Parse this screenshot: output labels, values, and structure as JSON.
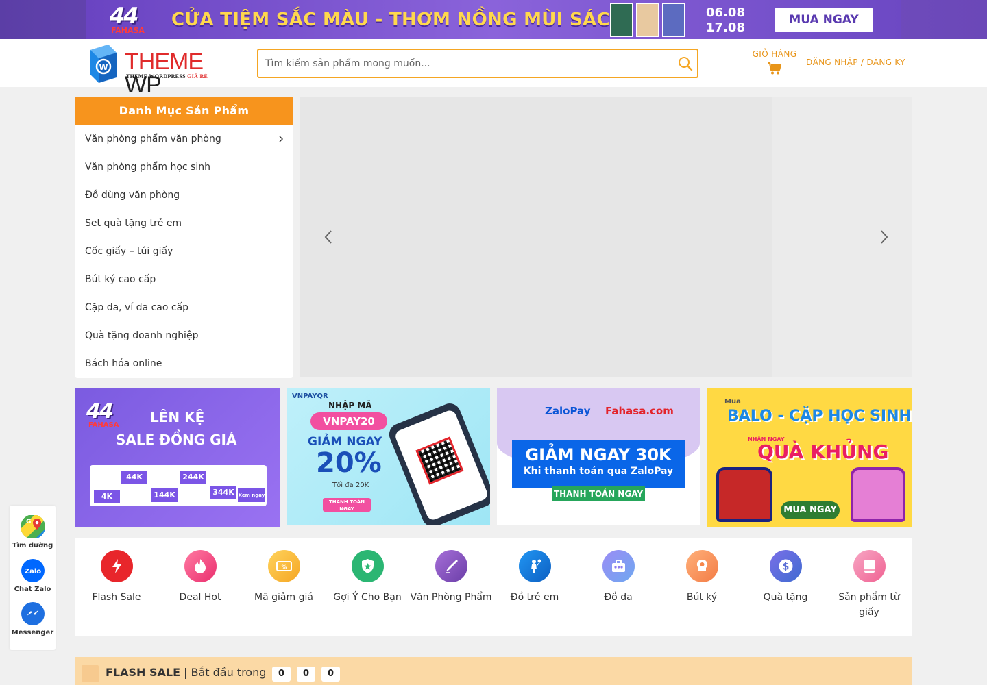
{
  "top_banner": {
    "brand_number": "44",
    "brand_name": "FAHASA",
    "slogan": "CỬA TIỆM SẮC MÀU - THƠM NỒNG MÙI SÁCH",
    "date_start": "06.08",
    "date_end": "17.08",
    "cta": "MUA NGAY"
  },
  "header": {
    "logo_part1": "THEME",
    "logo_part2": " WP",
    "logo_sub_part1": "THEME WORDPRESS ",
    "logo_sub_part2": "GIÁ RẺ",
    "search_placeholder": "Tìm kiếm sản phẩm mong muốn...",
    "cart_label": "GIỎ HÀNG",
    "login_label": "ĐĂNG NHẬP / ĐĂNG KÝ"
  },
  "category_menu": {
    "title": "Danh Mục Sản Phẩm",
    "items": [
      {
        "label": "Văn phòng phẩm văn phòng"
      },
      {
        "label": "Văn phòng phẩm học sinh"
      },
      {
        "label": "Đồ dùng văn phòng"
      },
      {
        "label": "Set quà tặng trẻ em"
      },
      {
        "label": "Cốc giấy – túi giấy"
      },
      {
        "label": "Bút ký cao cấp"
      },
      {
        "label": "Cặp da, ví da cao cấp"
      },
      {
        "label": "Quà tặng doanh nghiệp"
      },
      {
        "label": "Bách hóa online"
      }
    ]
  },
  "promos": {
    "p1": {
      "number": "44",
      "brand": "FAHASA",
      "line1": "LÊN KỆ",
      "line2": "SALE ĐỒNG GIÁ",
      "tags": [
        "44K",
        "244K",
        "144K",
        "344K",
        "4K"
      ],
      "cta": "Xem ngay"
    },
    "p2": {
      "brand": "VNPAY",
      "brand_suffix": "QR",
      "enter": "NHẬP MÃ",
      "code": "VNPAY20",
      "discount_label": "GIẢM NGAY",
      "discount": "20%",
      "max": "Tối đa 20K",
      "cta": "THANH TOÁN NGAY"
    },
    "p3": {
      "brand1": "ZaloPay",
      "brand2": "Fahasa.com",
      "headline": "GIẢM NGAY 30K",
      "subline": "Khi thanh toán qua ZaloPay",
      "cta": "THANH TOÁN NGAY"
    },
    "p4": {
      "prefix": "Mua",
      "line1": "BALO - CẶP HỌC SINH",
      "note": "NHẬN NGAY",
      "line2": "QUÀ KHỦNG",
      "cta": "MUA NGAY"
    }
  },
  "quick_categories": [
    {
      "label": "Flash Sale",
      "icon": "lightning-icon",
      "color": "#e8262b"
    },
    {
      "label": "Deal Hot",
      "icon": "flame-icon",
      "color": "#f0497e"
    },
    {
      "label": "Mã giảm giá",
      "icon": "coupon-icon",
      "color": "#f7b731"
    },
    {
      "label": "Gợi Ý Cho Bạn",
      "icon": "star-shield-icon",
      "color": "#2bb673"
    },
    {
      "label": "Văn Phòng Phẩm",
      "icon": "pen-icon",
      "color": "#8e44ad"
    },
    {
      "label": "Đồ trẻ em",
      "icon": "child-icon",
      "color": "#1e88e5"
    },
    {
      "label": "Đồ da",
      "icon": "briefcase-icon",
      "color": "#8d7cf0"
    },
    {
      "label": "Bút ký",
      "icon": "idea-icon",
      "color": "#f7864a"
    },
    {
      "label": "Quà tặng",
      "icon": "dollar-icon",
      "color": "#5b6fd6"
    },
    {
      "label": "Sản phẩm từ giấy",
      "icon": "paper-icon",
      "color": "#f06292"
    }
  ],
  "flash_sale": {
    "title": "FLASH SALE",
    "subtitle": "| Bắt đầu trong",
    "countdown": [
      "0",
      "0",
      "0"
    ]
  },
  "contact": {
    "map_label": "Tìm đường",
    "zalo_label": "Chat Zalo",
    "zalo_icon_text": "Zalo",
    "messenger_label": "Messenger"
  }
}
